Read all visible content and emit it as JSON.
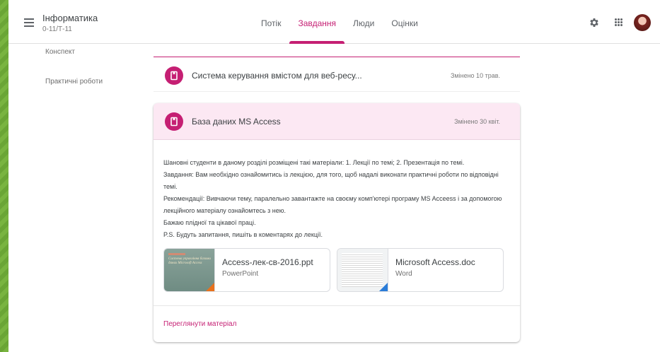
{
  "header": {
    "class_name": "Інформатика",
    "class_section": "0-11/Т-11",
    "tabs": [
      {
        "label": "Потік"
      },
      {
        "label": "Завдання"
      },
      {
        "label": "Люди"
      },
      {
        "label": "Оцінки"
      }
    ],
    "active_tab": "Завдання"
  },
  "sidebar": {
    "items": [
      {
        "label": "Конспект"
      },
      {
        "label": "Практичні роботи"
      }
    ]
  },
  "items": [
    {
      "title": "Система керування вмістом для веб-ресу...",
      "date": "Змінено 10 трав."
    }
  ],
  "card": {
    "title": "База даних MS Access",
    "date": "Змінено 30 квіт.",
    "description": [
      "Шановні студенти в даному розділі розміщені такі матеріали: 1. Лекції по темі; 2. Презентація по темі.",
      "Завдання: Вам необхідно ознайомитись із лекцією, для того, щоб надалі виконати практичні роботи по відповідні",
      "темі.",
      "Рекомендації: Вивчаючи тему, паралельно завантажте на своєму комп'ютері програму MS Acceess і за допомогою",
      "лекційного матеріалу ознайомтесь з нею.",
      "Бажаю плідної та цікавої праці.",
      "P.S. Будуть запитання, пишіть в коментарях до лекції."
    ],
    "attachments": [
      {
        "name": "Access-лек-св-2016.ppt",
        "type": "PowerPoint",
        "thumb_text": "Система управління базами даних Microsoft Access"
      },
      {
        "name": "Microsoft Access.doc",
        "type": "Word"
      }
    ],
    "view_link": "Переглянути матеріал"
  },
  "colors": {
    "accent": "#c51f73",
    "card_header": "#fce8f3",
    "frame_border": "#6aa535"
  }
}
